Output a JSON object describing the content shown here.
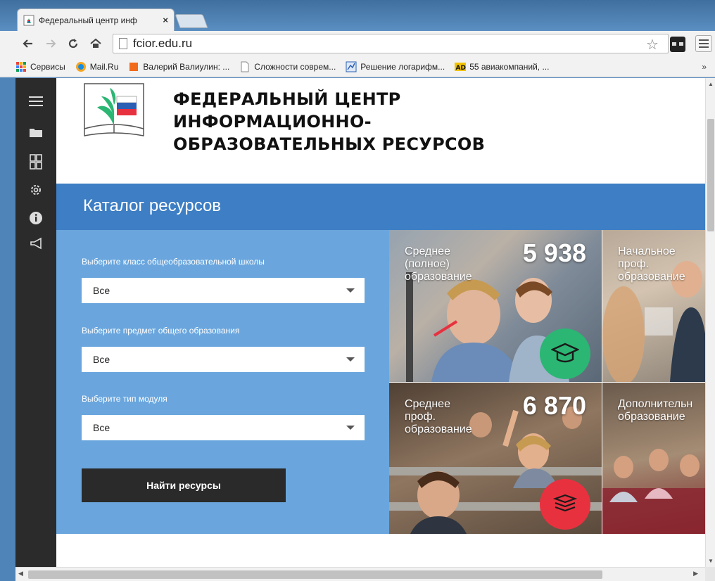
{
  "browser": {
    "tab_title": "Федеральный центр инф",
    "tab_close": "×",
    "url": "fcior.edu.ru",
    "bookmarks": [
      {
        "label": "Сервисы",
        "icon": "apps-icon",
        "color": "#e8453c"
      },
      {
        "label": "Mail.Ru",
        "icon": "mailru-icon",
        "color": "#168de2"
      },
      {
        "label": "Валерий Валиулин: ...",
        "icon": "blogger-icon",
        "color": "#f26a1b"
      },
      {
        "label": "Сложности соврем...",
        "icon": "page-icon",
        "color": "#888888"
      },
      {
        "label": "Решение логарифм...",
        "icon": "chart-icon",
        "color": "#2b5fb4"
      },
      {
        "label": "55 авиакомпаний, ...",
        "icon": "ad-icon",
        "color": "#f2c200"
      }
    ],
    "bookmarks_more": "»"
  },
  "site": {
    "title_lines": [
      "ФЕДЕРАЛЬНЫЙ ЦЕНТР",
      "ИНФОРМАЦИОННО-",
      "ОБРАЗОВАТЕЛЬНЫХ РЕСУРСОВ"
    ],
    "catalog_heading": "Каталог ресурсов",
    "form": {
      "class_label": "Выберите класс общеобразовательной школы",
      "class_value": "Все",
      "subject_label": "Выберите предмет общего образования",
      "subject_value": "Все",
      "module_label": "Выберите тип модуля",
      "module_value": "Все",
      "submit_label": "Найти ресурсы"
    },
    "tiles": [
      {
        "lines": [
          "Среднее",
          "(полное)",
          "образование"
        ],
        "count": "5 938",
        "badge_icon": "graduation-cap-icon",
        "badge_color": "#2bb673"
      },
      {
        "lines": [
          "Начальное",
          "проф.",
          "образование"
        ],
        "count": "",
        "badge_icon": "",
        "badge_color": ""
      },
      {
        "lines": [
          "Среднее",
          "проф.",
          "образование"
        ],
        "count": "6 870",
        "badge_icon": "books-icon",
        "badge_color": "#e8313f"
      },
      {
        "lines": [
          "Дополнительн",
          "образование"
        ],
        "count": "",
        "badge_icon": "",
        "badge_color": ""
      }
    ]
  },
  "colors": {
    "catalog_bar": "#3d7ec4",
    "form_panel": "#6aa6dd",
    "submit_button": "#2a2a2a",
    "left_nav": "#2b2b2b"
  }
}
